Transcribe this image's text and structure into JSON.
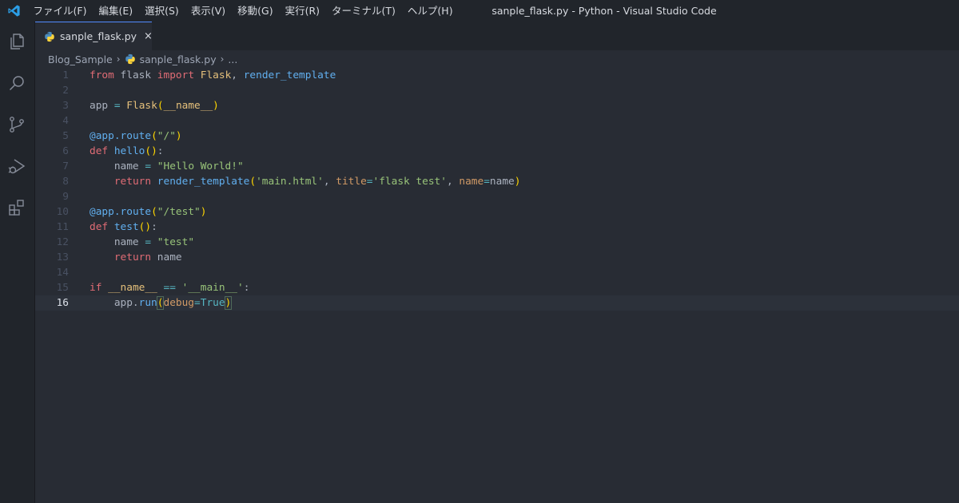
{
  "titlebar": {
    "menu": [
      "ファイル(F)",
      "編集(E)",
      "選択(S)",
      "表示(V)",
      "移動(G)",
      "実行(R)",
      "ターミナル(T)",
      "ヘルプ(H)"
    ],
    "window_title": "sanple_flask.py - Python - Visual Studio Code"
  },
  "activitybar": {
    "icons": [
      "files-icon",
      "search-icon",
      "source-control-icon",
      "run-debug-icon",
      "extensions-icon"
    ]
  },
  "tab": {
    "label": "sanple_flask.py",
    "close": "×"
  },
  "breadcrumb": {
    "folder": "Blog_Sample",
    "file": "sanple_flask.py",
    "more": "..."
  },
  "editor": {
    "current_line": 16,
    "line_numbers": [
      "1",
      "2",
      "3",
      "4",
      "5",
      "6",
      "7",
      "8",
      "9",
      "10",
      "11",
      "12",
      "13",
      "14",
      "15",
      "16"
    ],
    "lines": [
      "from flask import Flask, render_template",
      "",
      "app = Flask(__name__)",
      "",
      "@app.route(\"/\")",
      "def hello():",
      "    name = \"Hello World!\"",
      "    return render_template('main.html', title='flask test', name=name)",
      "",
      "@app.route(\"/test\")",
      "def test():",
      "    name = \"test\"",
      "    return name",
      "",
      "if __name__ == '__main__':",
      "    app.run(debug=True)"
    ]
  },
  "colors": {
    "editor_bg": "#282c34",
    "sidebar_bg": "#21252b",
    "keyword": "#c678dd",
    "function": "#61afef",
    "string": "#98c379",
    "class": "#e5c07b",
    "variable": "#e06c75"
  }
}
